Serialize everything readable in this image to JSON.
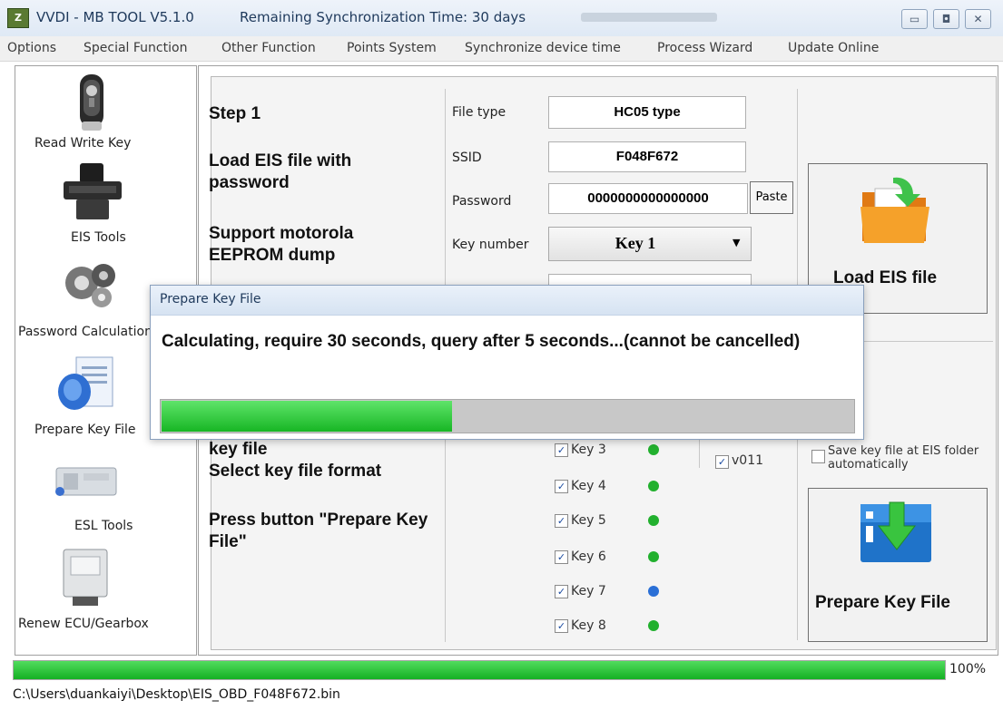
{
  "window": {
    "title": "VVDI - MB TOOL V5.1.0",
    "sync_text": "Remaining Synchronization Time: 30 days",
    "icon": "app-logo-icon",
    "controls": [
      "minimize",
      "maximize",
      "close"
    ]
  },
  "menu": [
    "Options",
    "Special Function",
    "Other Function",
    "Points System",
    "Synchronize device time",
    "Process Wizard",
    "Update Online"
  ],
  "sidebar": {
    "items": [
      {
        "label": "Read Write Key",
        "icon": "car-key-icon"
      },
      {
        "label": "EIS Tools",
        "icon": "eis-module-icon"
      },
      {
        "label": "Password Calculation",
        "icon": "gears-icon"
      },
      {
        "label": "Prepare Key File",
        "icon": "key-file-icon"
      },
      {
        "label": "ESL Tools",
        "icon": "esl-module-icon"
      },
      {
        "label": "Renew ECU/Gearbox",
        "icon": "ecu-icon"
      }
    ]
  },
  "steps": {
    "step1": "Step 1",
    "load_eis": "Load EIS file with password",
    "support": "Support motorola EEPROM dump",
    "key_file": "key file",
    "select_format": "Select key file format",
    "press_button": "Press button \"Prepare Key File\""
  },
  "fields": {
    "file_type": {
      "label": "File type",
      "value": "HC05 type"
    },
    "ssid": {
      "label": "SSID",
      "value": "F048F672"
    },
    "password": {
      "label": "Password",
      "value": "0000000000000000",
      "paste": "Paste"
    },
    "key_number": {
      "label": "Key number",
      "value": "Key 1"
    }
  },
  "buttons": {
    "load_eis": "Load EIS file",
    "prepare": "Prepare Key File",
    "load_icon": "folder-open-icon",
    "prepare_icon": "download-arrow-icon"
  },
  "keys": [
    {
      "label": "Key 3",
      "checked": true,
      "status": "green"
    },
    {
      "label": "Key 4",
      "checked": true,
      "status": "green"
    },
    {
      "label": "Key 5",
      "checked": true,
      "status": "green"
    },
    {
      "label": "Key 6",
      "checked": true,
      "status": "green"
    },
    {
      "label": "Key 7",
      "checked": true,
      "status": "blue"
    },
    {
      "label": "Key 8",
      "checked": true,
      "status": "green"
    }
  ],
  "version_option": {
    "label": "v011",
    "checked": true
  },
  "save_option": {
    "label": "Save key file at EIS folder automatically",
    "checked": false
  },
  "dialog": {
    "title": "Prepare Key File",
    "message": "Calculating, require 30 seconds, query after 5 seconds...(cannot be cancelled)",
    "progress": 0.42
  },
  "bottom": {
    "progress": 1.0,
    "progress_label": "100%",
    "status_path": "C:\\Users\\duankaiyi\\Desktop\\EIS_OBD_F048F672.bin"
  },
  "colors": {
    "progress_green": "#17b624",
    "status_green": "#22b02e",
    "status_blue": "#2a6fd6"
  }
}
